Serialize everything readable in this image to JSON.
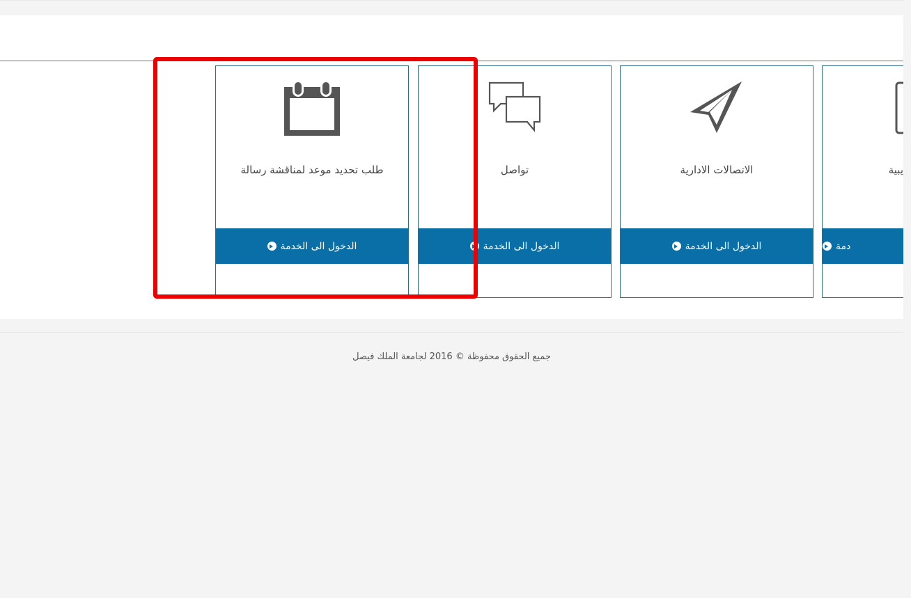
{
  "cards": [
    {
      "title": "طلب تحديد موعد لمناقشة رسالة",
      "button_label": "الدخول الى الخدمة",
      "icon": "calendar-icon"
    },
    {
      "title": "تواصل",
      "button_label": "الدخول الى الخدمة",
      "icon": "chat-bubbles-icon"
    },
    {
      "title": "الاتصالات الادارية",
      "button_label": "الدخول الى الخدمة",
      "icon": "paper-plane-icon"
    },
    {
      "title": "يبية",
      "button_label": "دمة",
      "icon": "tablet-icon"
    }
  ],
  "footer": {
    "copyright": "جميع الحقوق محفوظة © 2016 لجامعة الملك فيصل"
  },
  "colors": {
    "button_bg": "#0a6fa6",
    "card_border": "#2f6d8f",
    "highlight": "#ee0000",
    "icon": "#555555"
  }
}
